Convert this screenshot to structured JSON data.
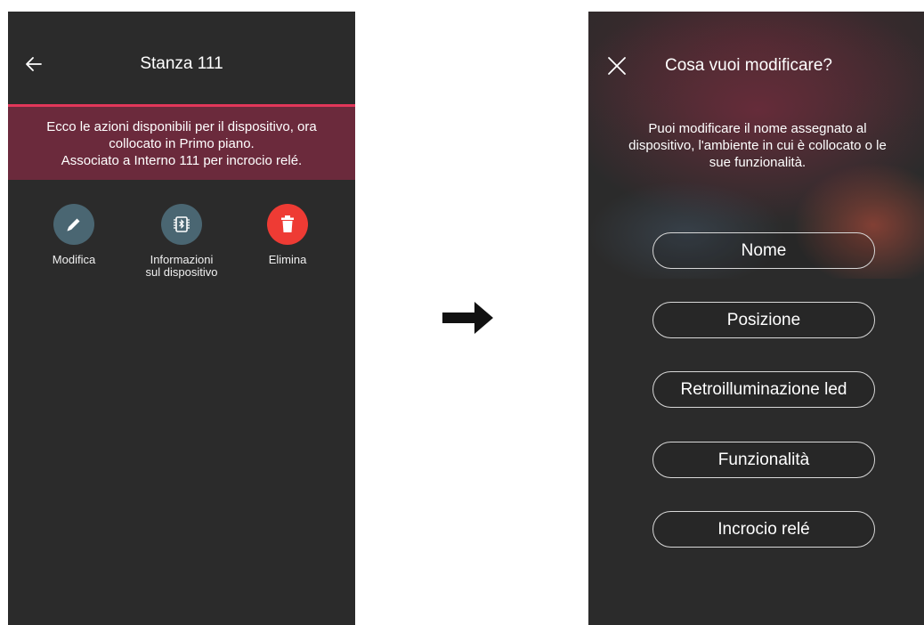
{
  "left_screen": {
    "title": "Stanza 111",
    "banner_line1": "Ecco le azioni disponibili per il dispositivo, ora",
    "banner_line2": "collocato in Primo piano.",
    "banner_line3": "Associato a Interno 111 per incrocio relé.",
    "actions": [
      {
        "label_line1": "Modifica",
        "label_line2": "",
        "icon": "pencil-icon",
        "color": "#4a6672"
      },
      {
        "label_line1": "Informazioni",
        "label_line2": "sul dispositivo",
        "icon": "bluetooth-chip-icon",
        "color": "#4a6672"
      },
      {
        "label_line1": "Elimina",
        "label_line2": "",
        "icon": "trash-icon",
        "color": "#ee3b34"
      }
    ]
  },
  "right_screen": {
    "title": "Cosa vuoi modificare?",
    "description_line1": "Puoi modificare il nome assegnato al",
    "description_line2": "dispositivo, l'ambiente in cui è collocato o le",
    "description_line3": "sue funzionalità.",
    "options": [
      "Nome",
      "Posizione",
      "Retroilluminazione led",
      "Funzionalità",
      "Incrocio relé"
    ]
  },
  "colors": {
    "background": "#2b2b2b",
    "accent_line": "#e2375a",
    "banner": "#6b2a3c",
    "delete_red": "#ee3b34",
    "icon_teal": "#4a6672"
  }
}
